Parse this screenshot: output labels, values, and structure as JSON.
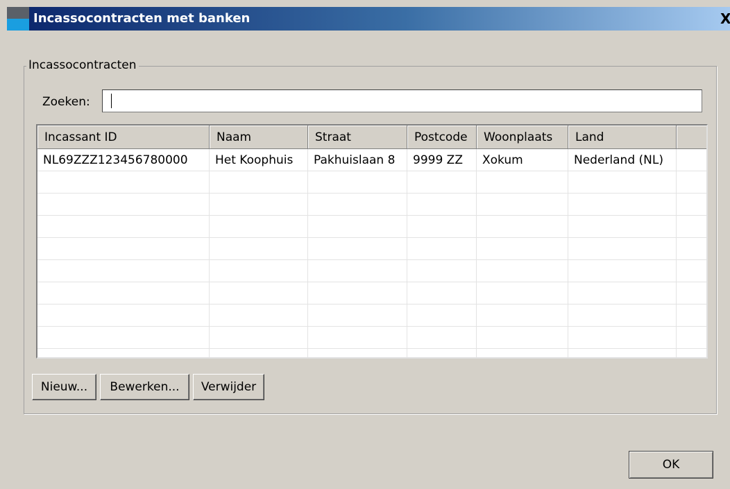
{
  "window": {
    "title": "Incassocontracten met banken",
    "close_label": "X"
  },
  "group": {
    "legend": "Incassocontracten"
  },
  "search": {
    "label": "Zoeken:",
    "value": ""
  },
  "table": {
    "columns": [
      "Incassant ID",
      "Naam",
      "Straat",
      "Postcode",
      "Woonplaats",
      "Land",
      ""
    ],
    "rows": [
      [
        "NL69ZZZ123456780000",
        "Het Koophuis",
        "Pakhuislaan 8",
        "9999 ZZ",
        "Xokum",
        "Nederland (NL)",
        ""
      ]
    ]
  },
  "buttons": {
    "new": "Nieuw...",
    "edit": "Bewerken...",
    "delete": "Verwijder",
    "ok": "OK"
  },
  "colors": {
    "titlebar_start": "#0a246a",
    "titlebar_end": "#a6caf0",
    "dialog_bg": "#d4d0c8"
  }
}
